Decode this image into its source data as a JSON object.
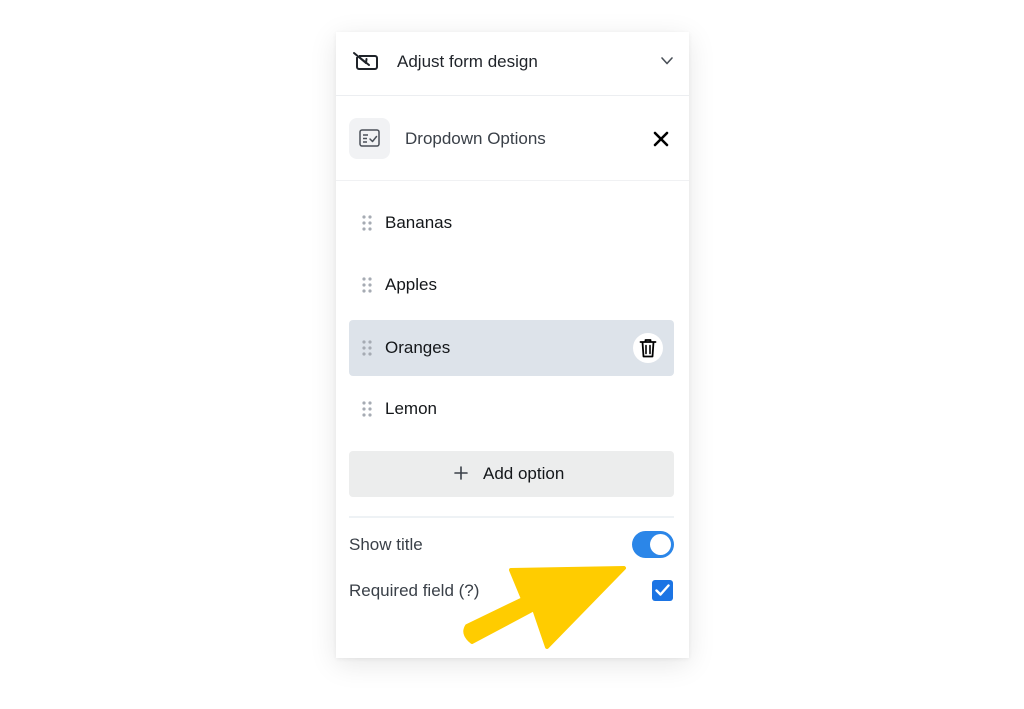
{
  "header": {
    "title": "Adjust form design"
  },
  "section": {
    "title": "Dropdown Options"
  },
  "options": [
    {
      "label": "Bananas",
      "selected": false
    },
    {
      "label": "Apples",
      "selected": false
    },
    {
      "label": "Oranges",
      "selected": true
    },
    {
      "label": "Lemon",
      "selected": false
    }
  ],
  "add_option_label": "Add option",
  "settings": {
    "show_title": {
      "label": "Show title",
      "enabled": true
    },
    "required_field": {
      "label": "Required field (?)",
      "checked": true
    }
  },
  "icons": {
    "header": "form-design-icon",
    "section": "dropdown-list-icon",
    "collapse": "chevron-down-icon",
    "close": "close-icon",
    "drag": "drag-handle-icon",
    "delete": "trash-icon",
    "add": "plus-icon",
    "annotation": "arrow-annotation"
  },
  "colors": {
    "accent": "#2b86e8",
    "checkbox": "#1b74e4",
    "selected_row": "#dde3ea",
    "button_bg": "#eceded",
    "annotation_arrow": "#ffcc00"
  }
}
